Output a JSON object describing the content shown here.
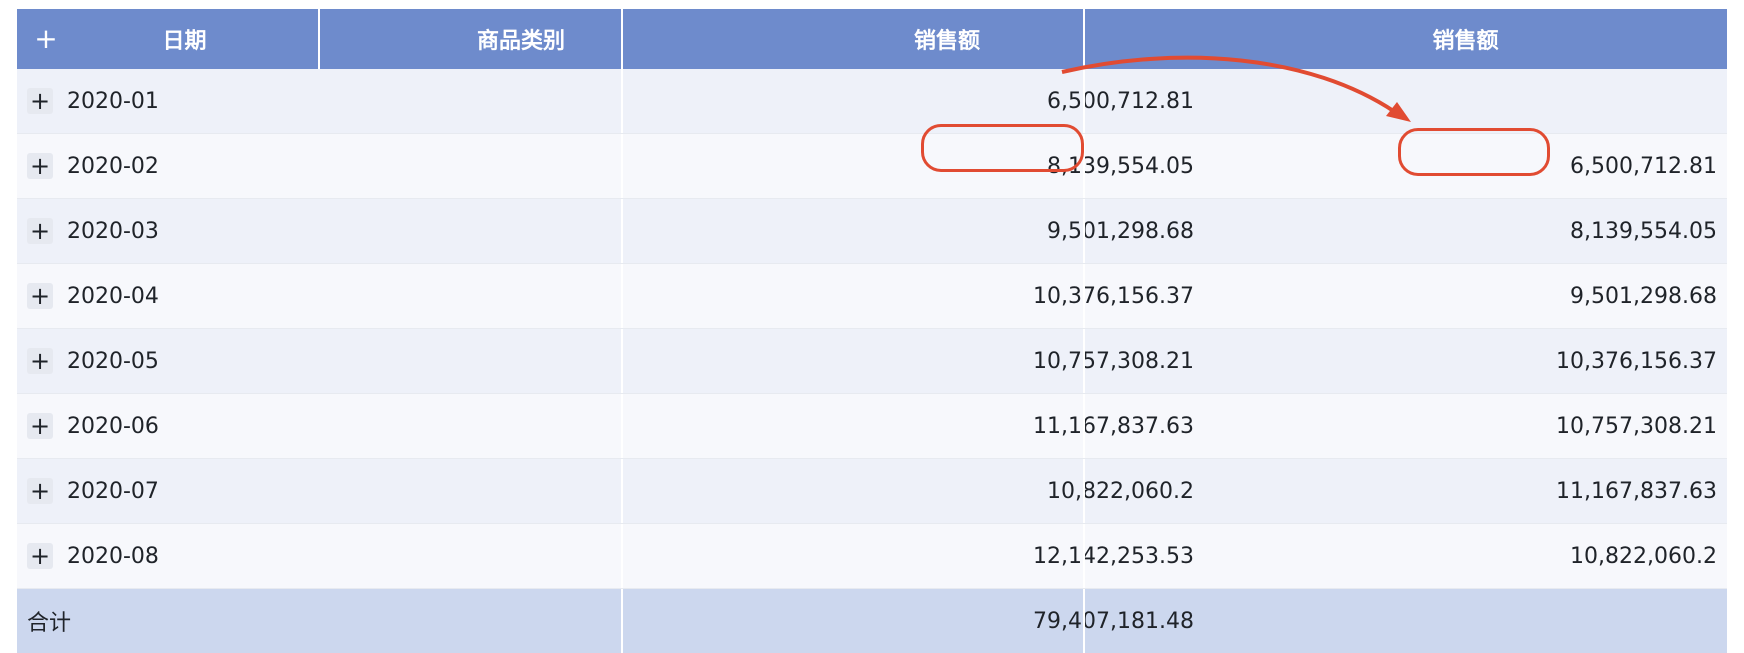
{
  "table": {
    "header": {
      "expand_all_symbol": "+",
      "columns": [
        "日期",
        "商品类别",
        "销售额",
        "销售额"
      ]
    },
    "rows": [
      {
        "date": "2020-01",
        "category": "",
        "sales": "6,500,712.81",
        "sales_prev": ""
      },
      {
        "date": "2020-02",
        "category": "",
        "sales": "8,139,554.05",
        "sales_prev": "6,500,712.81"
      },
      {
        "date": "2020-03",
        "category": "",
        "sales": "9,501,298.68",
        "sales_prev": "8,139,554.05"
      },
      {
        "date": "2020-04",
        "category": "",
        "sales": "10,376,156.37",
        "sales_prev": "9,501,298.68"
      },
      {
        "date": "2020-05",
        "category": "",
        "sales": "10,757,308.21",
        "sales_prev": "10,376,156.37"
      },
      {
        "date": "2020-06",
        "category": "",
        "sales": "11,167,837.63",
        "sales_prev": "10,757,308.21"
      },
      {
        "date": "2020-07",
        "category": "",
        "sales": "10,822,060.2",
        "sales_prev": "11,167,837.63"
      },
      {
        "date": "2020-08",
        "category": "",
        "sales": "12,142,253.53",
        "sales_prev": "10,822,060.2"
      }
    ],
    "expand_symbol": "+",
    "total": {
      "label": "合计",
      "sales": "79,407,181.48",
      "sales_prev": ""
    }
  },
  "colors": {
    "header_bg": "#6e8bcc",
    "row_odd": "#eef1f9",
    "row_even": "#f7f8fc",
    "total_bg": "#ccd7ee",
    "annotation": "#e14b32"
  }
}
